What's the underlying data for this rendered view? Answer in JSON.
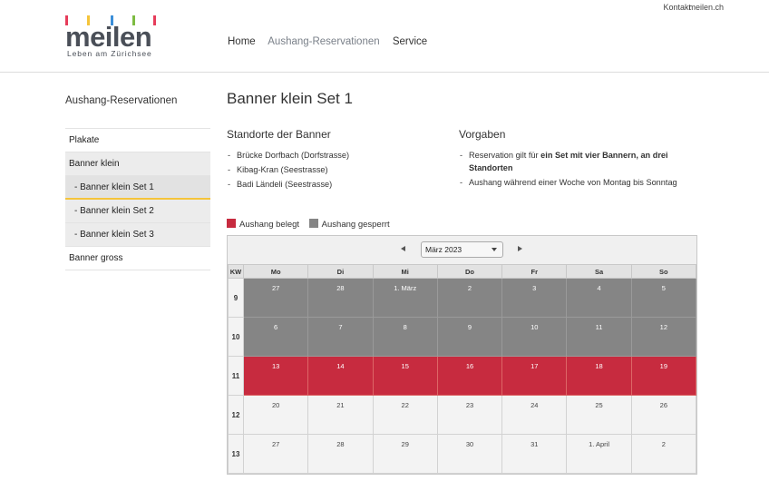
{
  "top_links": {
    "kontakt": "Kontakt",
    "site": "meilen.ch"
  },
  "logo": {
    "word": "meilen",
    "tagline": "Leben am Zürichsee",
    "bar_colors": [
      "#e63c5a",
      "#f5c43a",
      "#3b8fd9",
      "#7dbb42",
      "#e63c5a"
    ]
  },
  "nav": {
    "home": "Home",
    "reservations": "Aushang-Reservationen",
    "service": "Service"
  },
  "sidebar": {
    "title": "Aushang-Reservationen",
    "items": [
      "Plakate",
      "Banner klein",
      "- Banner klein Set 1",
      "- Banner klein Set 2",
      "- Banner klein Set 3",
      "Banner gross"
    ]
  },
  "page": {
    "title": "Banner klein Set 1",
    "locations": {
      "heading": "Standorte der Banner",
      "items": [
        "Brücke Dorfbach (Dorfstrasse)",
        "Kibag-Kran (Seestrasse)",
        "Badi Ländeli (Seestrasse)"
      ]
    },
    "rules": {
      "heading": "Vorgaben",
      "item1_prefix": "Reservation gilt für ",
      "item1_bold": "ein Set mit vier Bannern, an drei Standorten",
      "item2": "Aushang während einer Woche von Montag bis Sonntag"
    }
  },
  "legend": {
    "belegt": "Aushang belegt",
    "gesperrt": "Aushang gesperrt",
    "belegt_color": "#c72b3f",
    "gesperrt_color": "#858585"
  },
  "calendar": {
    "month": "März 2023",
    "kw_label": "KW",
    "days": [
      "Mo",
      "Di",
      "Mi",
      "Do",
      "Fr",
      "Sa",
      "So"
    ],
    "weeks": [
      {
        "kw": "9",
        "status": "gesperrt",
        "dates": [
          "27",
          "28",
          "1. März",
          "2",
          "3",
          "4",
          "5"
        ]
      },
      {
        "kw": "10",
        "status": "gesperrt",
        "dates": [
          "6",
          "7",
          "8",
          "9",
          "10",
          "11",
          "12"
        ]
      },
      {
        "kw": "11",
        "status": "belegt",
        "dates": [
          "13",
          "14",
          "15",
          "16",
          "17",
          "18",
          "19"
        ]
      },
      {
        "kw": "12",
        "status": "free",
        "dates": [
          "20",
          "21",
          "22",
          "23",
          "24",
          "25",
          "26"
        ]
      },
      {
        "kw": "13",
        "status": "free",
        "dates": [
          "27",
          "28",
          "29",
          "30",
          "31",
          "1. April",
          "2"
        ]
      }
    ]
  }
}
